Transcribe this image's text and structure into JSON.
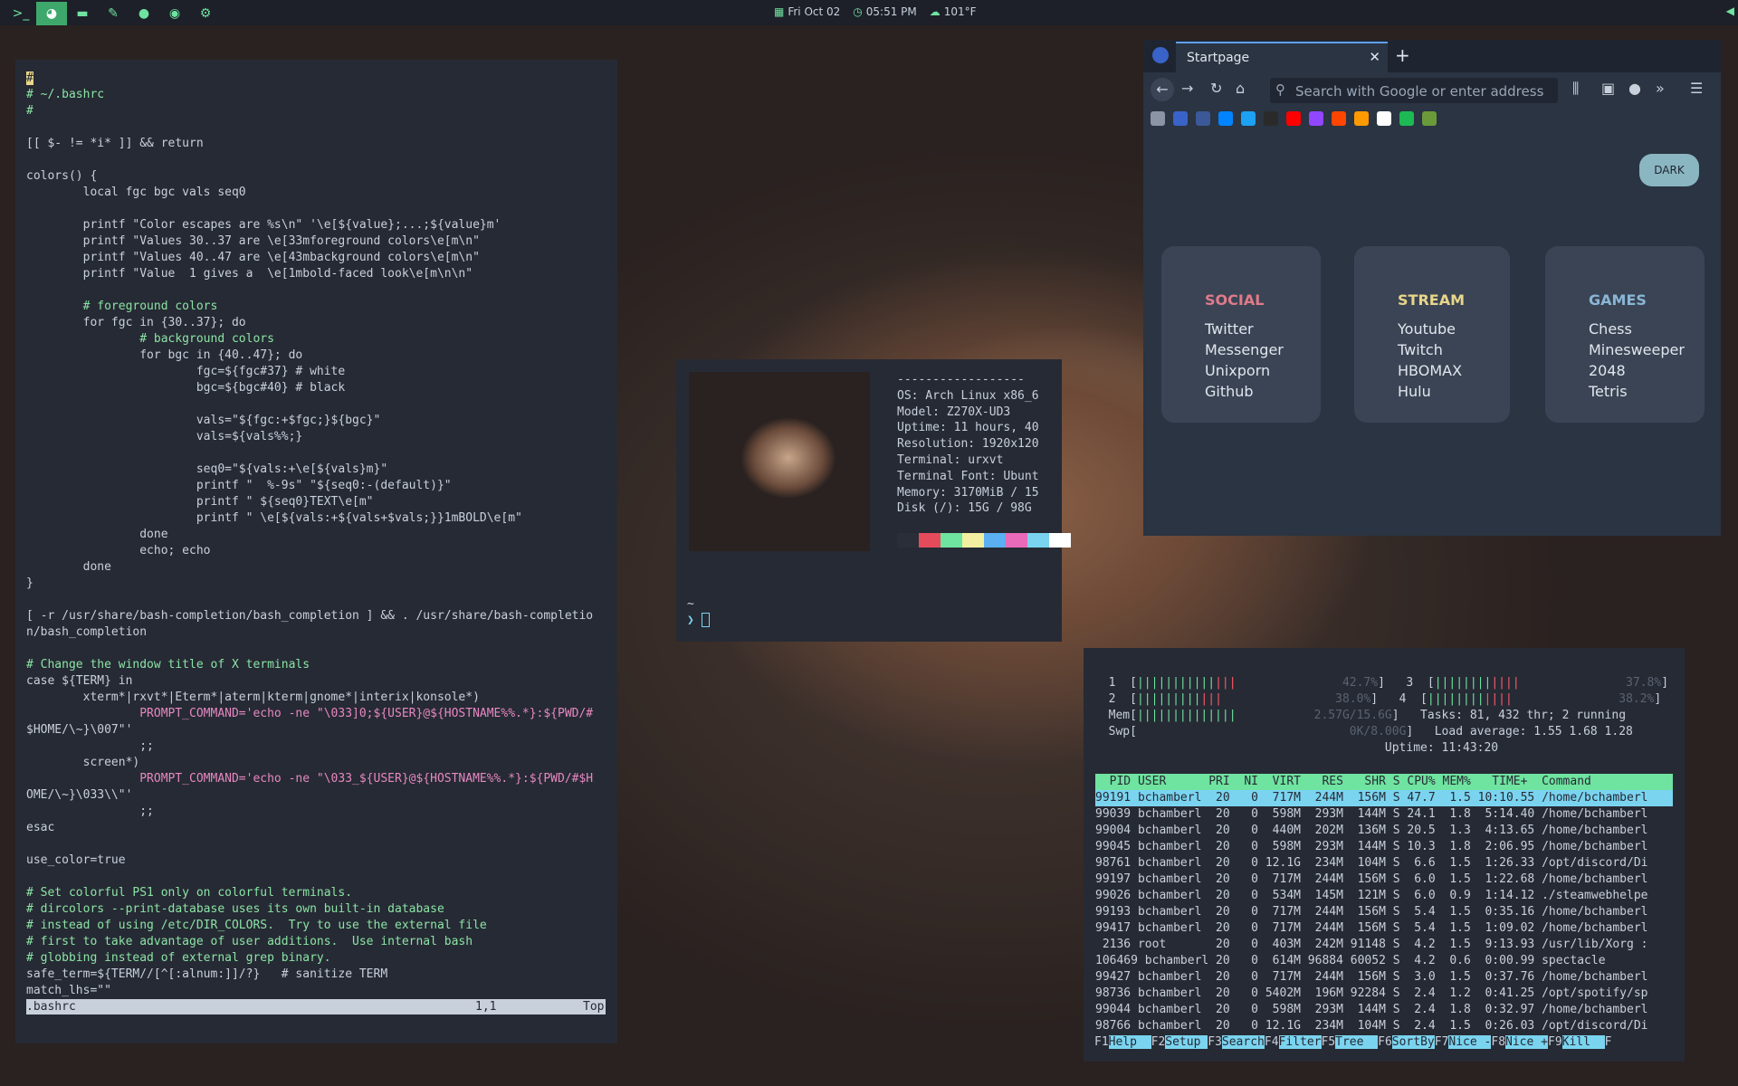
{
  "topbar": {
    "date": "Fri Oct 02",
    "time": "05:51 PM",
    "weather": "101°F"
  },
  "vim": {
    "lines": [
      "#",
      "# ~/.bashrc",
      "#",
      "",
      "[[ $- != *i* ]] && return",
      "",
      "colors() {",
      "        local fgc bgc vals seq0",
      "",
      "        printf \"Color escapes are %s\\n\" '\\e[${value};...;${value}m'",
      "        printf \"Values 30..37 are \\e[33mforeground colors\\e[m\\n\"",
      "        printf \"Values 40..47 are \\e[43mbackground colors\\e[m\\n\"",
      "        printf \"Value  1 gives a  \\e[1mbold-faced look\\e[m\\n\\n\"",
      "",
      "        # foreground colors",
      "        for fgc in {30..37}; do",
      "                # background colors",
      "                for bgc in {40..47}; do",
      "                        fgc=${fgc#37} # white",
      "                        bgc=${bgc#40} # black",
      "",
      "                        vals=\"${fgc:+$fgc;}${bgc}\"",
      "                        vals=${vals%%;}",
      "",
      "                        seq0=\"${vals:+\\e[${vals}m}\"",
      "                        printf \"  %-9s\" \"${seq0:-(default)}\"",
      "                        printf \" ${seq0}TEXT\\e[m\"",
      "                        printf \" \\e[${vals:+${vals+$vals;}}1mBOLD\\e[m\"",
      "                done",
      "                echo; echo",
      "        done",
      "}",
      "",
      "[ -r /usr/share/bash-completion/bash_completion ] && . /usr/share/bash-completio",
      "n/bash_completion",
      "",
      "# Change the window title of X terminals",
      "case ${TERM} in",
      "        xterm*|rxvt*|Eterm*|aterm|kterm|gnome*|interix|konsole*)",
      "                PROMPT_COMMAND='echo -ne \"\\033]0;${USER}@${HOSTNAME%%.*}:${PWD/#",
      "$HOME/\\~}\\007\"'",
      "                ;;",
      "        screen*)",
      "                PROMPT_COMMAND='echo -ne \"\\033_${USER}@${HOSTNAME%%.*}:${PWD/#$H",
      "OME/\\~}\\033\\\\\"'",
      "                ;;",
      "esac",
      "",
      "use_color=true",
      "",
      "# Set colorful PS1 only on colorful terminals.",
      "# dircolors --print-database uses its own built-in database",
      "# instead of using /etc/DIR_COLORS.  Try to use the external file",
      "# first to take advantage of user additions.  Use internal bash",
      "# globbing instead of external grep binary.",
      "safe_term=${TERM//[^[:alnum:]]/?}   # sanitize TERM",
      "match_lhs=\"\""
    ],
    "status_file": ".bashrc",
    "status_pos": "1,1",
    "status_scroll": "Top"
  },
  "neofetch": {
    "sep": "------------------",
    "os": "OS: Arch Linux x86_6",
    "model": "Model: Z270X-UD3",
    "uptime": "Uptime: 11 hours, 40",
    "resolution": "Resolution: 1920x120",
    "terminal": "Terminal: urxvt",
    "font": "Terminal Font: Ubunt",
    "memory": "Memory: 3170MiB / 15",
    "disk": "Disk (/): 15G / 98G",
    "swatches": [
      "#2a2e38",
      "#e54b5b",
      "#6fe3a0",
      "#f2f0a0",
      "#5ab0f0",
      "#e86ab8",
      "#7ad4f0",
      "#ffffff"
    ],
    "cwd": "~",
    "prompt": "❯"
  },
  "firefox": {
    "tab_title": "Startpage",
    "tab_close": "✕",
    "new_tab": "+",
    "url_placeholder": "Search with Google or enter address",
    "dark_button": "DARK",
    "bookmark_colors": [
      "#8a94a4",
      "#3a63c9",
      "#3b5998",
      "#0084ff",
      "#1da1f2",
      "#2a2a2a",
      "#ff0000",
      "#9146ff",
      "#ff4500",
      "#ff9900",
      "#ffffff",
      "#1db954",
      "#6a9a3a"
    ],
    "cards": [
      {
        "heading": "SOCIAL",
        "color": "#e07a8a",
        "links": [
          "Twitter",
          "Messenger",
          "Unixporn",
          "Github"
        ]
      },
      {
        "heading": "STREAM",
        "color": "#e8d68a",
        "links": [
          "Youtube",
          "Twitch",
          "HBOMAX",
          "Hulu"
        ]
      },
      {
        "heading": "GAMES",
        "color": "#8ab6d6",
        "links": [
          "Chess",
          "Minesweeper",
          "2048",
          "Tetris"
        ]
      }
    ]
  },
  "htop": {
    "cpu1_label": "1",
    "cpu1_pct": "42.7%",
    "cpu2_label": "2",
    "cpu2_pct": "38.0%",
    "cpu3_label": "3",
    "cpu3_pct": "37.8%",
    "cpu4_label": "4",
    "cpu4_pct": "38.2%",
    "mem_label": "Mem",
    "mem_val": "2.57G/15.6G",
    "swp_label": "Swp",
    "swp_val": "0K/8.00G",
    "tasks": "Tasks: 81, 432 thr; 2 running",
    "load": "Load average: 1.55 1.68 1.28",
    "uptime": "Uptime: 11:43:20",
    "header": "  PID USER      PRI  NI  VIRT   RES   SHR S CPU% MEM%   TIME+  Command",
    "rows": [
      "99191 bchamberl  20   0  717M  244M  156M S 47.7  1.5 10:10.55 /home/bchamberl",
      "99039 bchamberl  20   0  598M  293M  144M S 24.1  1.8  5:14.40 /home/bchamberl",
      "99004 bchamberl  20   0  440M  202M  136M S 20.5  1.3  4:13.65 /home/bchamberl",
      "99045 bchamberl  20   0  598M  293M  144M S 10.3  1.8  2:06.95 /home/bchamberl",
      "98761 bchamberl  20   0 12.1G  234M  104M S  6.6  1.5  1:26.33 /opt/discord/Di",
      "99197 bchamberl  20   0  717M  244M  156M S  6.0  1.5  1:22.68 /home/bchamberl",
      "99026 bchamberl  20   0  534M  145M  121M S  6.0  0.9  1:14.12 ./steamwebhelpe",
      "99193 bchamberl  20   0  717M  244M  156M S  5.4  1.5  0:35.16 /home/bchamberl",
      "99417 bchamberl  20   0  717M  244M  156M S  5.4  1.5  1:09.02 /home/bchamberl",
      " 2136 root       20   0  403M  242M 91148 S  4.2  1.5  9:13.93 /usr/lib/Xorg :",
      "106469 bchamberl 20   0  614M 96884 60052 S  4.2  0.6  0:00.99 spectacle",
      "99427 bchamberl  20   0  717M  244M  156M S  3.0  1.5  0:37.76 /home/bchamberl",
      "98736 bchamberl  20   0 5402M  196M 92284 S  2.4  1.2  0:41.25 /opt/spotify/sp",
      "99044 bchamberl  20   0  598M  293M  144M S  2.4  1.8  0:32.97 /home/bchamberl",
      "98766 bchamberl  20   0 12.1G  234M  104M S  2.4  1.5  0:26.03 /opt/discord/Di"
    ],
    "fkeys": [
      {
        "k": "F1",
        "l": "Help  "
      },
      {
        "k": "F2",
        "l": "Setup "
      },
      {
        "k": "F3",
        "l": "Search"
      },
      {
        "k": "F4",
        "l": "Filter"
      },
      {
        "k": "F5",
        "l": "Tree  "
      },
      {
        "k": "F6",
        "l": "SortBy"
      },
      {
        "k": "F7",
        "l": "Nice -"
      },
      {
        "k": "F8",
        "l": "Nice +"
      },
      {
        "k": "F9",
        "l": "Kill  "
      },
      {
        "k": "F",
        "l": ""
      }
    ]
  }
}
